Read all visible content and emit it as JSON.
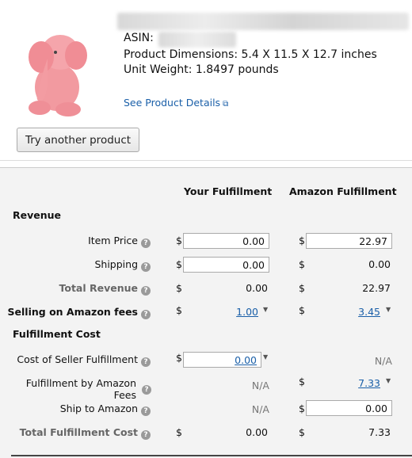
{
  "product": {
    "asin_label": "ASIN:",
    "dimensions": "Product Dimensions: 5.4 X 11.5 X 12.7 inches",
    "weight": "Unit Weight: 1.8497 pounds",
    "details_link": "See Product Details",
    "try_button": "Try another product"
  },
  "columns": {
    "yours": "Your Fulfillment",
    "amazon": "Amazon Fulfillment"
  },
  "sections": {
    "revenue": "Revenue",
    "fulfillment": "Fulfillment Cost"
  },
  "rows": {
    "item_price": {
      "label": "Item Price",
      "your_cur": "$",
      "your_val": "0.00",
      "amz_cur": "$",
      "amz_val": "22.97"
    },
    "shipping": {
      "label": "Shipping",
      "your_cur": "$",
      "your_val": "0.00",
      "amz_cur": "$",
      "amz_val": "0.00"
    },
    "total_revenue": {
      "label": "Total Revenue",
      "your_cur": "$",
      "your_val": "0.00",
      "amz_cur": "$",
      "amz_val": "22.97"
    },
    "selling_fees": {
      "label": "Selling on Amazon fees",
      "your_cur": "$",
      "your_val": "1.00",
      "amz_cur": "$",
      "amz_val": "3.45"
    },
    "seller_fulfillment": {
      "label": "Cost of Seller Fulfillment",
      "your_cur": "$",
      "your_val": "0.00",
      "amz_val": "N/A"
    },
    "fba_fees": {
      "label1": "Fulfillment by Amazon",
      "label2": "Fees",
      "your_val": "N/A",
      "amz_cur": "$",
      "amz_val": "7.33"
    },
    "ship_to_amazon": {
      "label": "Ship to Amazon",
      "your_val": "N/A",
      "amz_cur": "$",
      "amz_val": "0.00"
    },
    "total_fulfillment": {
      "label": "Total Fulfillment Cost",
      "your_cur": "$",
      "your_val": "0.00",
      "amz_cur": "$",
      "amz_val": "7.33"
    }
  },
  "icons": {
    "help": "help-icon",
    "external": "external-link-icon",
    "dropdown": "dropdown-caret-icon"
  }
}
